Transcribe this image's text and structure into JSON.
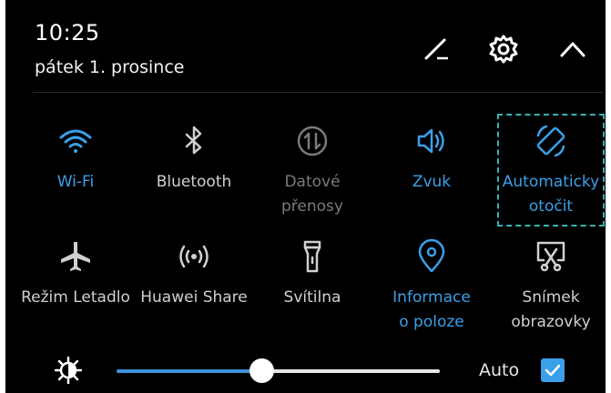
{
  "status": {
    "time": "10:25",
    "date": "pátek 1. prosince"
  },
  "header_icons": [
    "edit-icon",
    "settings-gear-icon",
    "collapse-chevron-up-icon"
  ],
  "tiles": [
    {
      "label1": "Wi-Fi",
      "label2": "",
      "icon": "wifi-icon",
      "state": "on"
    },
    {
      "label1": "Bluetooth",
      "label2": "",
      "icon": "bluetooth-icon",
      "state": "off"
    },
    {
      "label1": "Datové",
      "label2": "přenosy",
      "icon": "mobile-data-icon",
      "state": "disabled"
    },
    {
      "label1": "Zvuk",
      "label2": "",
      "icon": "sound-icon",
      "state": "on"
    },
    {
      "label1": "Automaticky",
      "label2": "otočit",
      "icon": "auto-rotate-icon",
      "state": "on"
    },
    {
      "label1": "Režim Letadlo",
      "label2": "",
      "icon": "airplane-icon",
      "state": "off"
    },
    {
      "label1": "Huawei Share",
      "label2": "",
      "icon": "huawei-share-icon",
      "state": "off"
    },
    {
      "label1": "Svítilna",
      "label2": "",
      "icon": "flashlight-icon",
      "state": "off"
    },
    {
      "label1": "Informace",
      "label2": "o poloze",
      "icon": "location-icon",
      "state": "on"
    },
    {
      "label1": "Snímek",
      "label2": "obrazovky",
      "icon": "screenshot-icon",
      "state": "off"
    }
  ],
  "brightness": {
    "level": 0.45,
    "auto_label": "Auto",
    "auto_checked": true
  },
  "colors": {
    "accent": "#3aa0e8",
    "background": "#000000",
    "highlight": "#36b3b3"
  }
}
